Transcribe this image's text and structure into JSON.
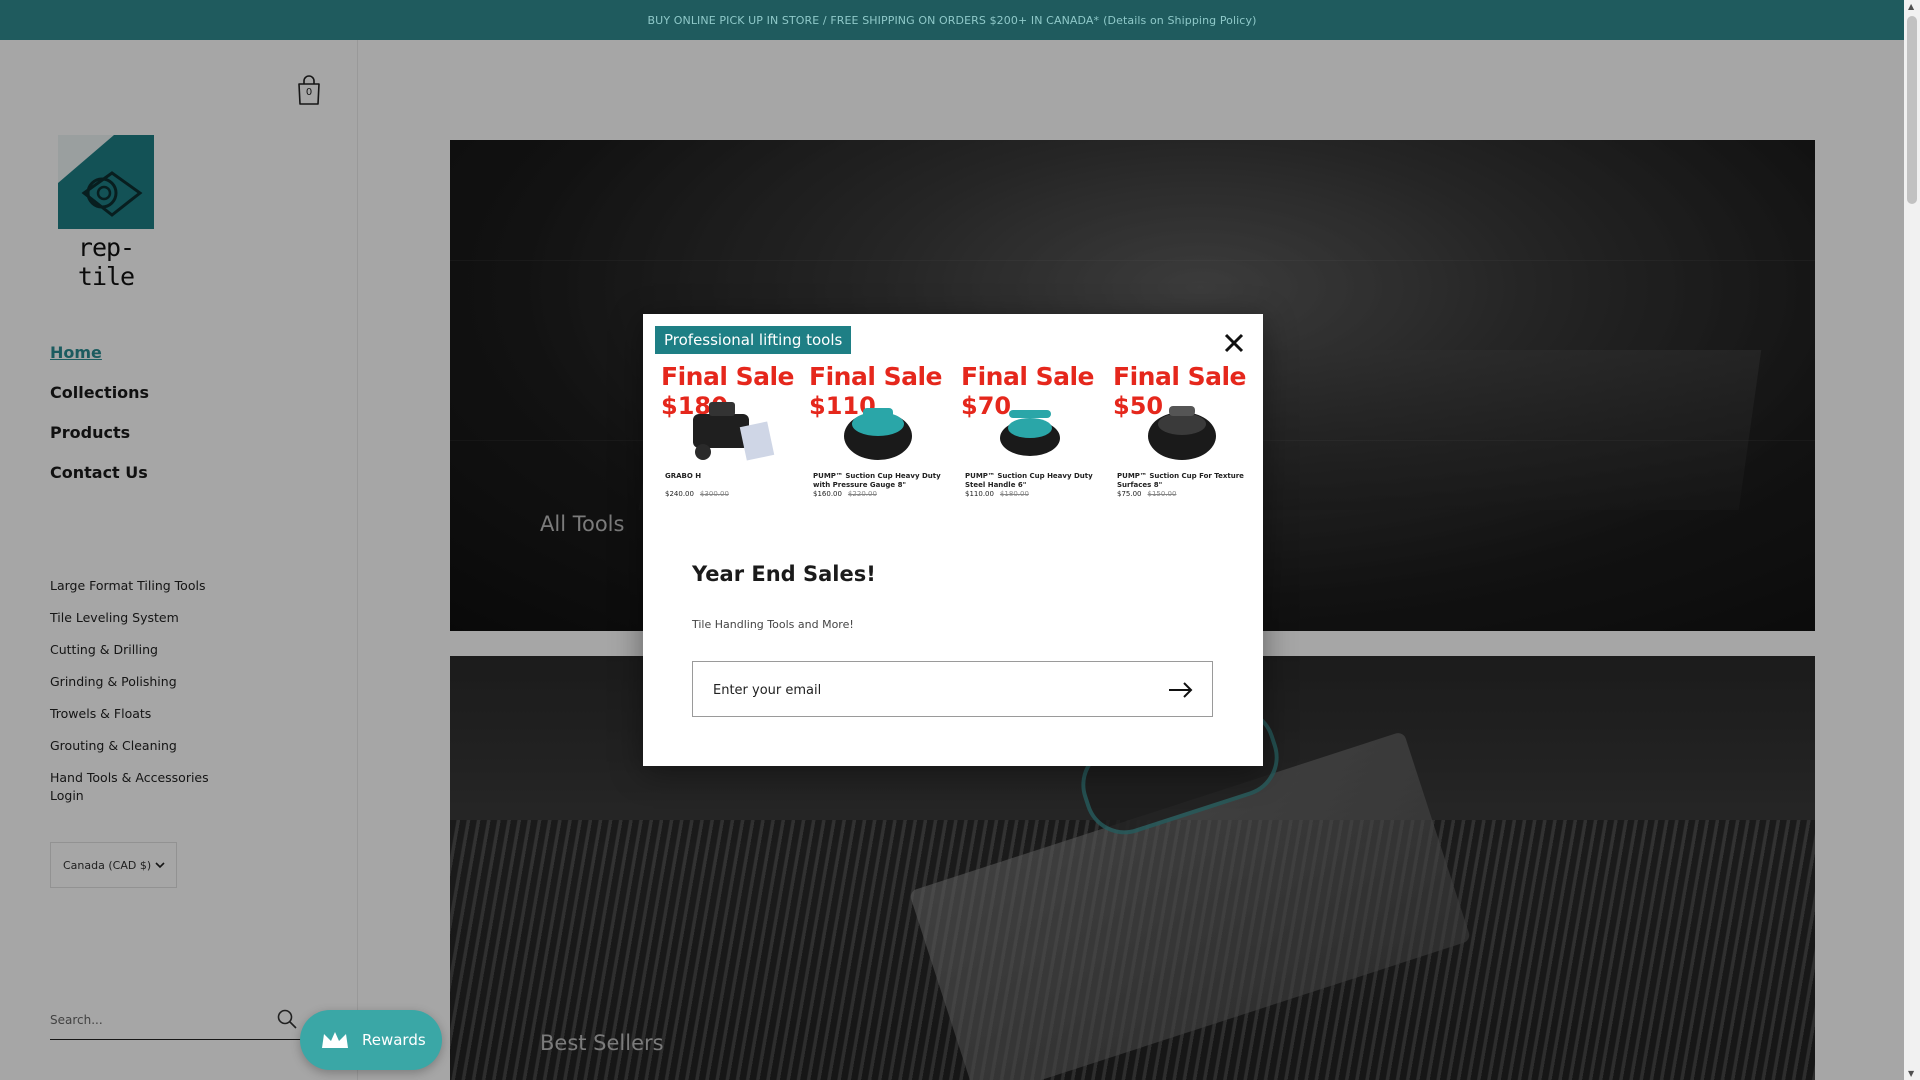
{
  "announcement": {
    "main": "BUY ONLINE PICK UP IN STORE / FREE SHIPPING ON ORDERS $200+ IN CANADA*",
    "details": "(Details on Shipping Policy)"
  },
  "header": {
    "cart_count": "0",
    "cart_icon": "shopping-bag-icon"
  },
  "brand": {
    "logo_text": "rep-tile",
    "accent": "#1e7f85"
  },
  "nav": {
    "main": [
      {
        "label": "Home",
        "active": true
      },
      {
        "label": "Collections"
      },
      {
        "label": "Products"
      },
      {
        "label": "Contact Us"
      }
    ],
    "categories": [
      "Large Format Tiling Tools",
      "Tile Leveling System",
      "Cutting & Drilling",
      "Grinding & Polishing",
      "Trowels & Floats",
      "Grouting & Cleaning",
      "Hand Tools & Accessories"
    ],
    "login": "Login"
  },
  "currency": {
    "selected": "Canada (CAD $)"
  },
  "search": {
    "placeholder": "Search..."
  },
  "rewards": {
    "label": "Rewards",
    "color": "#3aa7a6"
  },
  "hero": [
    {
      "label": "All Tools"
    },
    {
      "label": "Best Sellers"
    }
  ],
  "modal": {
    "promo_badge": "Professional lifting tools",
    "products": [
      {
        "headline": "Final Sale",
        "price": "$180",
        "name": "GRABO H",
        "current": "$240.00",
        "was": "$300.00"
      },
      {
        "headline": "Final Sale",
        "price": "$110",
        "name": "PUMP™ Suction Cup Heavy Duty with Pressure Gauge 8\"",
        "current": "$160.00",
        "was": "$220.00"
      },
      {
        "headline": "Final Sale",
        "price": "$70",
        "name": "PUMP™ Suction Cup Heavy Duty Steel Handle 6\"",
        "current": "$110.00",
        "was": "$180.00"
      },
      {
        "headline": "Final Sale",
        "price": "$50",
        "name": "PUMP™ Suction Cup For Texture Surfaces 8\"",
        "current": "$75.00",
        "was": "$150.00"
      }
    ],
    "title": "Year End Sales!",
    "subtitle": "Tile Handling Tools and More!",
    "email_placeholder": "Enter your email"
  }
}
